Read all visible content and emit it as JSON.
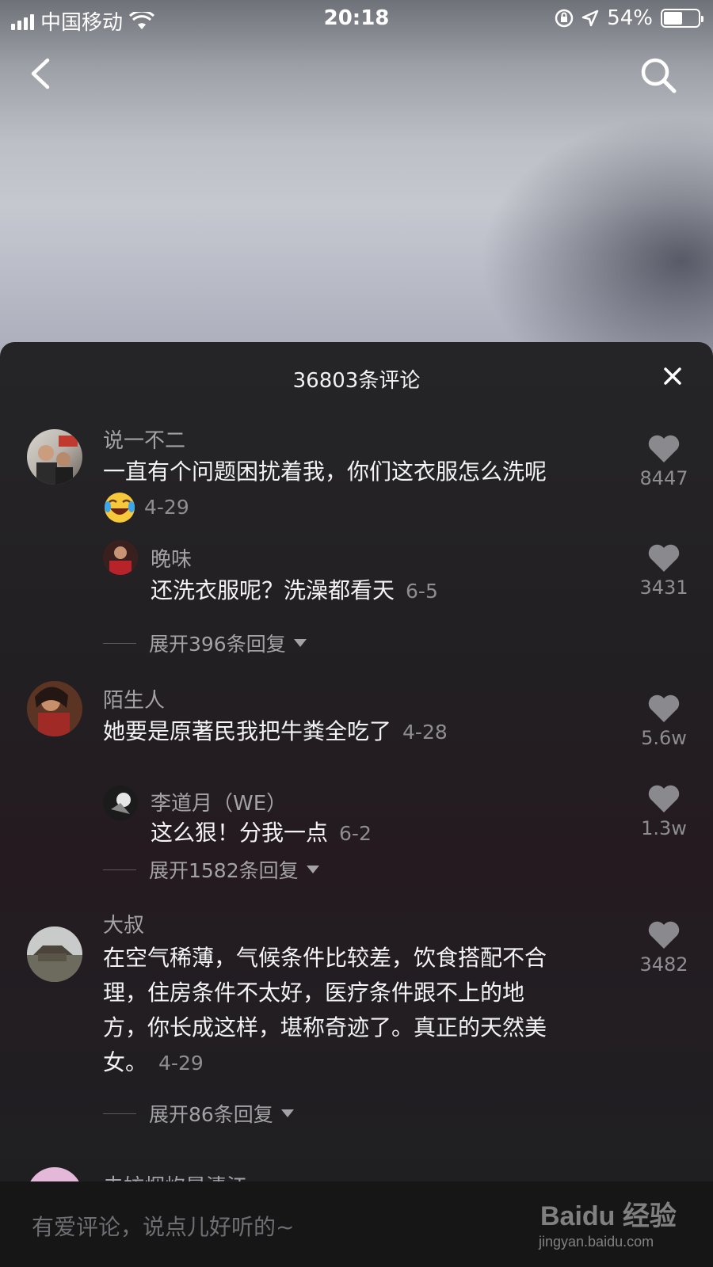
{
  "status_bar": {
    "carrier": "中国移动",
    "time": "20:18",
    "battery_percent": "54%",
    "battery_level": 0.54
  },
  "nav": {
    "back_icon": "chevron-left-icon",
    "search_icon": "search-icon"
  },
  "panel": {
    "title": "36803条评论",
    "close_icon": "close-icon"
  },
  "comments": [
    {
      "username": "说一不二",
      "text": "一直有个问题困扰着我，你们这衣服怎么洗呢",
      "emoji": "laughing-tears-emoji",
      "date": "4-29",
      "likes": "8447",
      "reply": {
        "username": "晚味",
        "text": "还洗衣服呢？洗澡都看天",
        "date": "6-5",
        "likes": "3431"
      },
      "expand": "展开396条回复"
    },
    {
      "username": "陌生人",
      "text": "她要是原著民我把牛粪全吃了",
      "date": "4-28",
      "likes": "5.6w",
      "reply": {
        "username": "李道月（WE）",
        "text": "这么狠！分我一点",
        "date": "6-2",
        "likes": "1.3w"
      },
      "expand": "展开1582条回复"
    },
    {
      "username": "大叔",
      "lines": [
        "在空气稀薄，气候条件比较差，饮食搭配不合",
        "理，住房条件不太好，医疗条件跟不上的地",
        "方，你长成这样，堪称奇迹了。真正的天然美",
        "女。"
      ],
      "date": "4-29",
      "likes": "3482",
      "expand": "展开86条回复"
    },
    {
      "username": "去妨烟炊是清江"
    }
  ],
  "input": {
    "placeholder": "有爱评论，说点儿好听的~"
  },
  "watermark": {
    "brand": "Baidu 经验",
    "url": "jingyan.baidu.com"
  }
}
